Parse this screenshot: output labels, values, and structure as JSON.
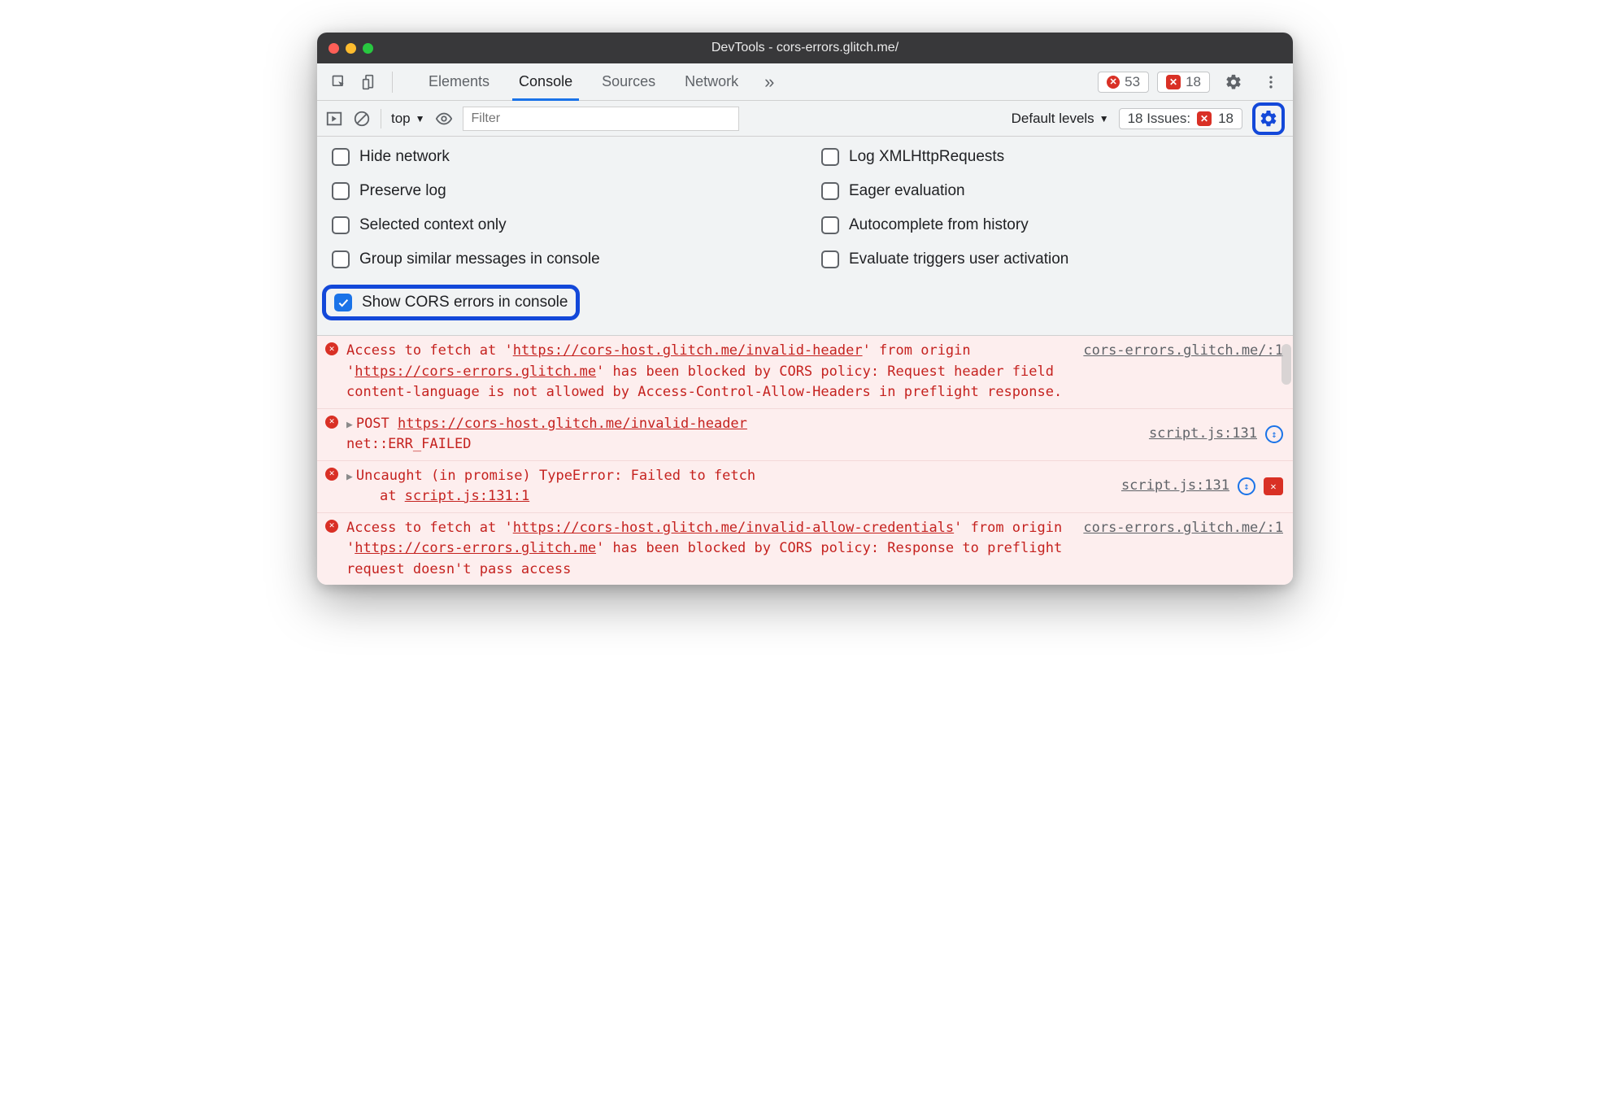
{
  "window": {
    "title": "DevTools - cors-errors.glitch.me/"
  },
  "toolbar": {
    "tabs": [
      "Elements",
      "Console",
      "Sources",
      "Network"
    ],
    "active_tab": "Console",
    "error_badge": {
      "count": "53"
    },
    "issue_badge": {
      "count": "18"
    }
  },
  "subtoolbar": {
    "context": "top",
    "filter_placeholder": "Filter",
    "levels_label": "Default levels",
    "issues_label": "18 Issues:",
    "issues_count": "18"
  },
  "settings": {
    "left": [
      {
        "label": "Hide network",
        "checked": false
      },
      {
        "label": "Preserve log",
        "checked": false
      },
      {
        "label": "Selected context only",
        "checked": false
      },
      {
        "label": "Group similar messages in console",
        "checked": false
      },
      {
        "label": "Show CORS errors in console",
        "checked": true,
        "highlight": true
      }
    ],
    "right": [
      {
        "label": "Log XMLHttpRequests",
        "checked": false
      },
      {
        "label": "Eager evaluation",
        "checked": false
      },
      {
        "label": "Autocomplete from history",
        "checked": false
      },
      {
        "label": "Evaluate triggers user activation",
        "checked": false
      }
    ]
  },
  "logs": [
    {
      "type": "error",
      "prefix": "Access to fetch at '",
      "url1": "https://cors-host.glitch.me/invalid-header",
      "mid": "' from origin '",
      "url2": "https://cors-errors.glitch.me",
      "suffix": "' has been blocked by CORS policy: Request header field content-language is not allowed by Access-Control-Allow-Headers in preflight response.",
      "source": "cors-errors.glitch.me/:1"
    },
    {
      "type": "net-error",
      "method": "POST",
      "url": "https://cors-host.glitch.me/invalid-header",
      "net": "net::ERR_FAILED",
      "source": "script.js:131",
      "refresh": true
    },
    {
      "type": "exception",
      "text": "Uncaught (in promise) TypeError: Failed to fetch",
      "stack": "at ",
      "stack_loc": "script.js:131:1",
      "source": "script.js:131",
      "refresh": true,
      "issue_flag": true
    },
    {
      "type": "error",
      "prefix": "Access to fetch at '",
      "url1": "https://cors-host.glitch.me/invalid-allow-credentials",
      "mid": "' from origin '",
      "url2": "https://cors-errors.glitch.me",
      "suffix": "' has been blocked by CORS policy: Response to preflight request doesn't pass access",
      "source": "cors-errors.glitch.me/:1"
    }
  ]
}
